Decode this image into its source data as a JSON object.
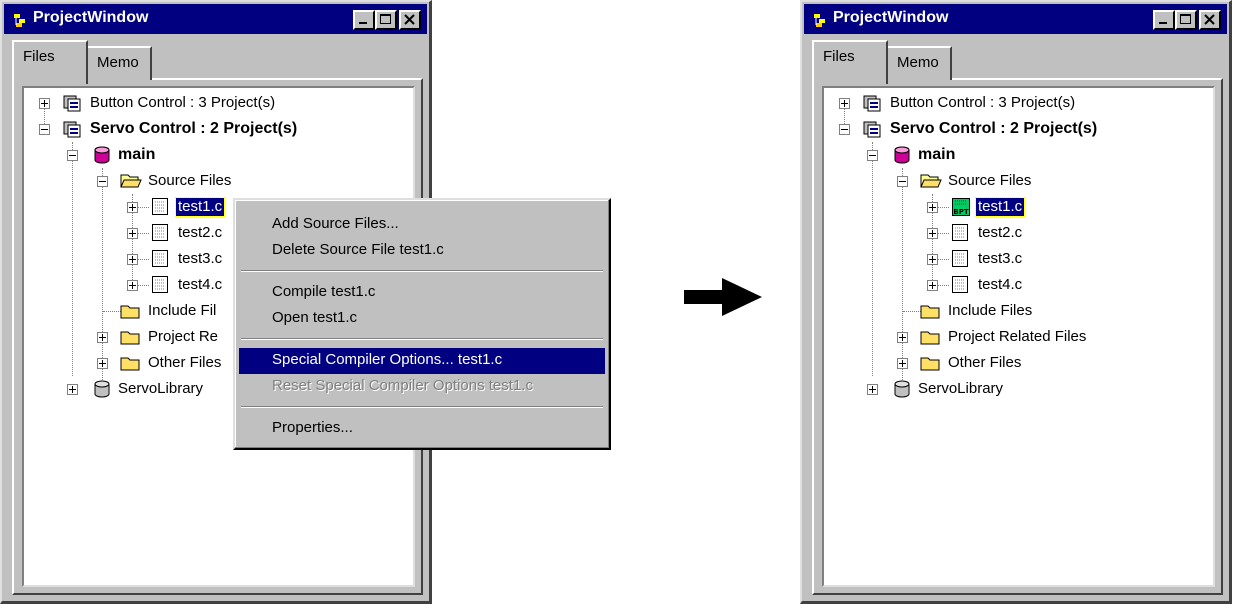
{
  "left_window": {
    "title": "ProjectWindow",
    "tabs": [
      "Files",
      "Memo"
    ],
    "tree": {
      "button_control": "Button Control : 3 Project(s)",
      "servo_control": "Servo Control : 2 Project(s)",
      "main": "main",
      "source_files": "Source Files",
      "test1": "test1.c",
      "test2": "test2.c",
      "test3": "test3.c",
      "test4": "test4.c",
      "include_files": "Include Fil",
      "project_related": "Project Re",
      "other_files": "Other Files",
      "servo_library": "ServoLibrary"
    }
  },
  "context_menu": {
    "items": {
      "add_source": "Add Source Files...",
      "delete_source": "Delete Source File  test1.c",
      "compile": "Compile  test1.c",
      "open": "Open  test1.c",
      "special_options": "Special Compiler Options...  test1.c",
      "reset_options": "Reset Special Compiler Options  test1.c",
      "properties": "Properties..."
    }
  },
  "right_window": {
    "title": "ProjectWindow",
    "tabs": [
      "Files",
      "Memo"
    ],
    "tree": {
      "button_control": "Button Control : 3 Project(s)",
      "servo_control": "Servo Control : 2 Project(s)",
      "main": "main",
      "source_files": "Source Files",
      "test1": "test1.c",
      "test2": "test2.c",
      "test3": "test3.c",
      "test4": "test4.c",
      "include_files": "Include Files",
      "project_related": "Project Related Files",
      "other_files": "Other Files",
      "servo_library": "ServoLibrary"
    },
    "bpt_badge": "BPT"
  }
}
